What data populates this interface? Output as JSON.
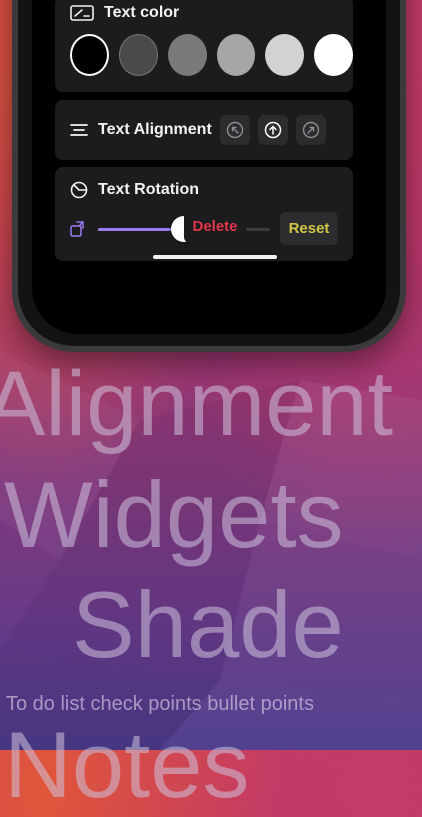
{
  "text_color": {
    "title": "Text color",
    "swatches": [
      "#000000",
      "#4a4a4a",
      "#7a7a7a",
      "#a6a6a6",
      "#d2d2d2",
      "#ffffff"
    ]
  },
  "alignment": {
    "title": "Text Alignment",
    "buttons": [
      {
        "icon": "arrow-up-left-icon",
        "selected": false
      },
      {
        "icon": "arrow-up-icon",
        "selected": true
      },
      {
        "icon": "arrow-up-right-icon",
        "selected": false
      }
    ]
  },
  "rotation": {
    "title": "Text Rotation",
    "slider_value": 0.5,
    "reset_label": "Reset"
  },
  "delete_label": "Delete",
  "promo": {
    "line1": "Alignment",
    "line2": "Widgets",
    "line3": "Shade",
    "line4": "To do list check points bullet points",
    "line5": "Notes"
  },
  "colors": {
    "accent": "#9c7cf2",
    "reset": "#d2c64a",
    "delete": "#e0364a"
  }
}
